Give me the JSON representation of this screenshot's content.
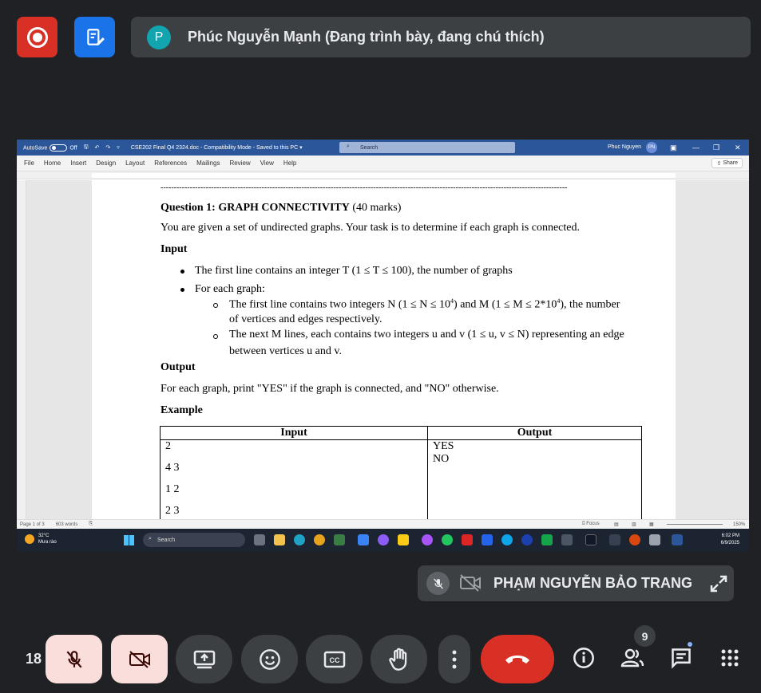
{
  "presenter": {
    "initial": "P",
    "title": "Phúc Nguyễn Mạnh (Đang trình bày, đang chú thích)"
  },
  "word": {
    "autosave_label": "AutoSave",
    "autosave_state": "Off",
    "doc_title": "CSE202 Final Q4 2324.doc  -  Compatibility Mode  -  Saved to this PC  ▾",
    "search_placeholder": "Search",
    "user_name": "Phuc Nguyen",
    "user_initials": "PN",
    "menu": [
      "File",
      "Home",
      "Insert",
      "Design",
      "Layout",
      "References",
      "Mailings",
      "Review",
      "View",
      "Help"
    ],
    "share_label": "Share",
    "status": {
      "page": "Page 1 of 3",
      "words": "603 words",
      "focus": "Focus",
      "zoom": "150%"
    }
  },
  "document": {
    "separator": "---------------------------------------------------------------------------------------------------------------------------------------------------------",
    "question_title": "Question 1: GRAPH CONNECTIVITY",
    "question_marks": " (40 marks)",
    "intro": "You are given a set of undirected graphs. Your task is to determine if each graph is connected.",
    "input_heading": "Input",
    "bullet1": "The first line contains an integer T (1 ≤ T ≤ 100), the number of graphs",
    "bullet2": "For each graph:",
    "sub1_a": "The first line contains two integers N (1 ≤ N ≤ 10",
    "sub1_sup1": "4",
    "sub1_b": ") and M (1 ≤ M ≤ 2*10",
    "sub1_sup2": "4",
    "sub1_c": "), the number",
    "sub1_line2": "of vertices and edges respectively.",
    "sub2_line1": "The next M lines, each contains two integers u and v (1 ≤ u, v ≤ N) representing an edge",
    "sub2_line2": "between vertices u and v.",
    "output_heading": "Output",
    "output_text": "For each graph, print \"YES\" if the graph is connected, and \"NO\" otherwise.",
    "example_heading": "Example",
    "table": {
      "headers": [
        "Input",
        "Output"
      ],
      "input_lines": [
        "2",
        "4 3",
        "1 2",
        "2 3"
      ],
      "output_lines": [
        "YES",
        "NO"
      ]
    }
  },
  "taskbar": {
    "temp": "32°C",
    "weather": "Mưa rào",
    "search": "Search",
    "time": "6:02 PM",
    "date": "6/9/2025"
  },
  "participant": {
    "name": "PHẠM NGUYỄN BẢO TRANG"
  },
  "controls": {
    "participant_count_left": "18",
    "people_badge": "9"
  }
}
